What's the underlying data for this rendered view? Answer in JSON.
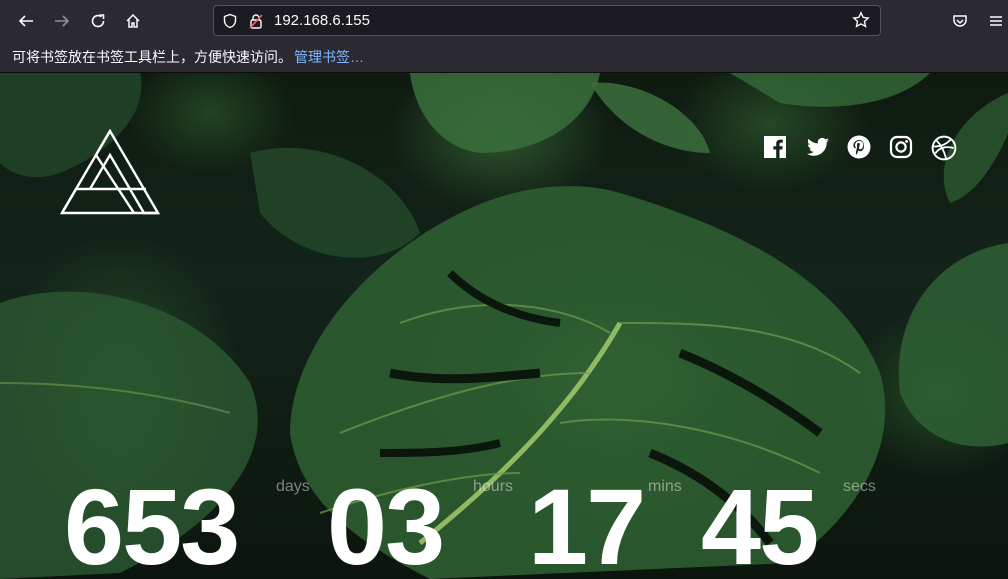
{
  "browser": {
    "url": "192.168.6.155",
    "bookmarks_prompt": "可将书签放在书签工具栏上，方便快速访问。",
    "bookmarks_link": "管理书签…"
  },
  "social": [
    "facebook-icon",
    "twitter-icon",
    "pinterest-icon",
    "instagram-icon",
    "dribbble-icon"
  ],
  "countdown": {
    "days": "653",
    "days_label": "days",
    "hours": "03",
    "hours_label": "hours",
    "mins": "17",
    "mins_label": "mins",
    "secs": "45",
    "secs_label": "secs"
  }
}
